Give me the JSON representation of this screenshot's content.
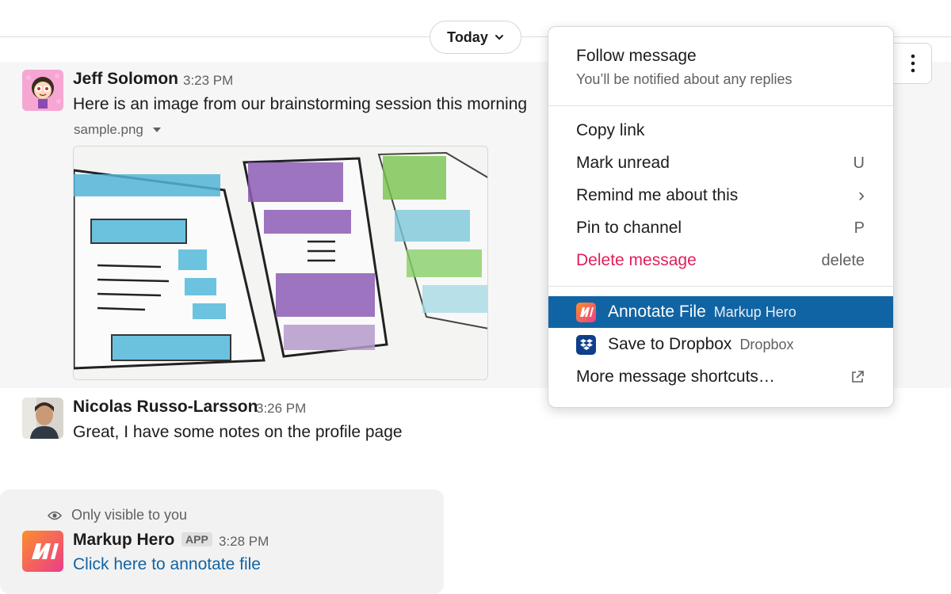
{
  "date_divider": {
    "label": "Today",
    "icon": "chevron-down-icon"
  },
  "messages": [
    {
      "author": "Jeff Solomon",
      "time": "3:23 PM",
      "text": "Here is an image from our brainstorming session this morning",
      "file": {
        "name": "sample.png",
        "icon": "caret-down-icon"
      }
    },
    {
      "author": "Nicolas Russo-Larsson",
      "time": "3:26 PM",
      "text": "Great, I have some notes on the profile page"
    }
  ],
  "ephemeral": {
    "visibility_note": "Only visible to you",
    "visibility_icon": "eye-icon",
    "author": "Markup Hero",
    "badge": "APP",
    "time": "3:28 PM",
    "link_text": "Click here to annotate file"
  },
  "more_actions_icon": "vertical-ellipsis-icon",
  "menu": {
    "follow": {
      "title": "Follow message",
      "subtitle": "You’ll be notified about any replies"
    },
    "items": [
      {
        "label": "Copy link",
        "shortcut": ""
      },
      {
        "label": "Mark unread",
        "shortcut": "U"
      },
      {
        "label": "Remind me about this",
        "shortcut": "›"
      },
      {
        "label": "Pin to channel",
        "shortcut": "P"
      },
      {
        "label": "Delete message",
        "shortcut": "delete"
      }
    ],
    "shortcuts": [
      {
        "label": "Annotate File",
        "app": "Markup Hero",
        "icon": "markup-hero-icon"
      },
      {
        "label": "Save to Dropbox",
        "app": "Dropbox",
        "icon": "dropbox-icon"
      },
      {
        "label": "More message shortcuts…",
        "icon": "external-link-icon"
      }
    ]
  },
  "colors": {
    "accent_selected": "#1164a3",
    "danger": "#e01e5a",
    "link": "#1264a3",
    "hover_bg": "#f6f6f6",
    "markup_hero_gradient": [
      "#fb8f2c",
      "#ec3c89"
    ],
    "dropbox": "#0f3f8a"
  }
}
